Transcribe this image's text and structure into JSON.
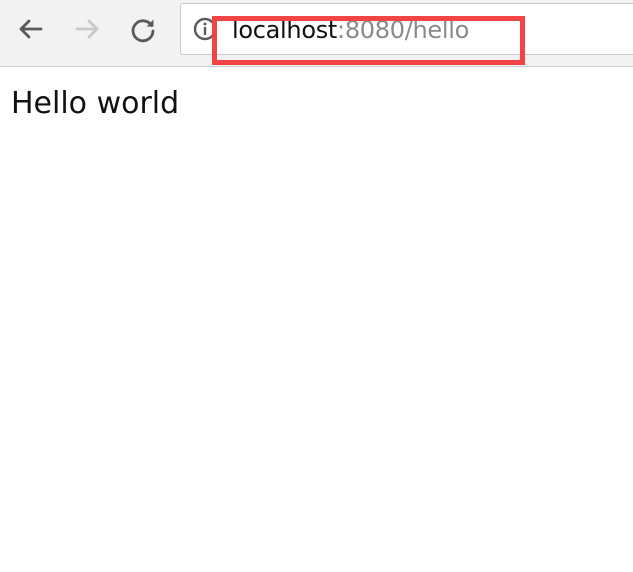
{
  "browser": {
    "toolbar": {
      "back_icon": "arrow-left-icon",
      "forward_icon": "arrow-right-icon",
      "reload_icon": "reload-icon",
      "info_icon": "info-icon"
    },
    "address_bar": {
      "host": "localhost",
      "rest": ":8080/hello"
    },
    "highlight_color": "#f24447"
  },
  "page": {
    "text": "Hello world"
  }
}
